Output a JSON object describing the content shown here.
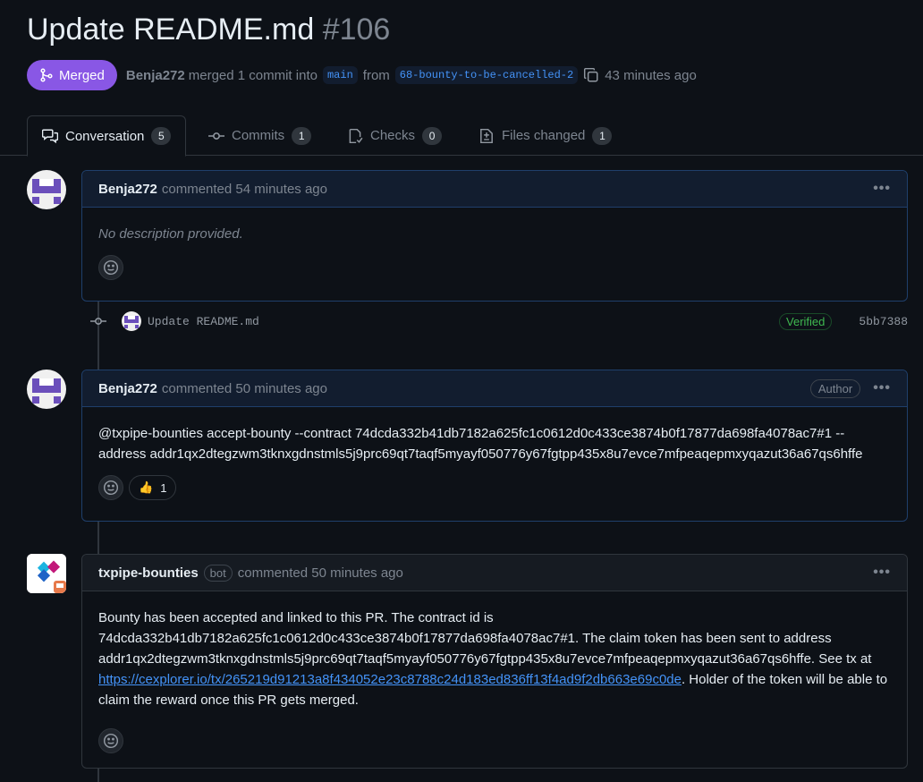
{
  "pr": {
    "title": "Update README.md",
    "number": "#106",
    "state": "Merged",
    "author": "Benja272",
    "merge_text": "merged 1 commit into",
    "base_branch": "main",
    "from_text": "from",
    "head_branch": "68-bounty-to-be-cancelled-2",
    "time": "43 minutes ago"
  },
  "tabs": [
    {
      "label": "Conversation",
      "count": "5",
      "icon": "comment-discussion-icon"
    },
    {
      "label": "Commits",
      "count": "1",
      "icon": "git-commit-icon"
    },
    {
      "label": "Checks",
      "count": "0",
      "icon": "checklist-icon"
    },
    {
      "label": "Files changed",
      "count": "1",
      "icon": "file-diff-icon"
    }
  ],
  "comments": [
    {
      "author": "Benja272",
      "time": "commented 54 minutes ago",
      "body": "No description provided."
    },
    {
      "author": "Benja272",
      "time": "commented 50 minutes ago",
      "role": "Author",
      "body": "@txpipe-bounties accept-bounty --contract 74dcda332b41db7182a625fc1c0612d0c433ce3874b0f17877da698fa4078ac7#1 --address addr1qx2dtegzwm3tknxgdnstmls5j9prc69qt7taqf5myayf050776y67fgtpp435x8u7evce7mfpeaqepmxyqazut36a67qs6hffe",
      "reaction_emoji": "👍",
      "reaction_count": "1"
    },
    {
      "author": "txpipe-bounties",
      "bot_label": "bot",
      "time": "commented 50 minutes ago",
      "body_pre": "Bounty has been accepted and linked to this PR. The contract id is 74dcda332b41db7182a625fc1c0612d0c433ce3874b0f17877da698fa4078ac7#1. The claim token has been sent to address addr1qx2dtegzwm3tknxgdnstmls5j9prc69qt7taqf5myayf050776y67fgtpp435x8u7evce7mfpeaqepmxyqazut36a67qs6hffe. See tx at ",
      "link": "https://cexplorer.io/tx/265219d91213a8f434052e23c8788c24d183ed836ff13f4ad9f2db663e69c0de",
      "body_post": ". Holder of the token will be able to claim the reward once this PR gets merged."
    }
  ],
  "commit": {
    "message": "Update README.md",
    "badge": "Verified",
    "sha": "5bb7388"
  },
  "colors": {
    "merged": "#8957e5",
    "link": "#4493f8",
    "verified": "#3fb950"
  }
}
